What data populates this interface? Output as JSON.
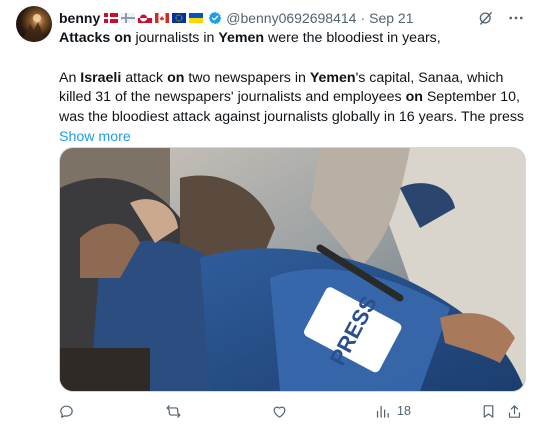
{
  "author": {
    "name": "benny",
    "handle": "@benny0692698414",
    "separator": "·",
    "date": "Sep 21",
    "flags": [
      "denmark-flag",
      "finland-flag",
      "greenland-flag",
      "canada-flag",
      "eu-flag",
      "ukraine-flag"
    ]
  },
  "tweet": {
    "line1": {
      "p1": "Attacks",
      "p2": " ",
      "p3": "on",
      "p4": " journalists in ",
      "p5": "Yemen",
      "p6": " were the bloodiest in years,"
    },
    "para2": {
      "p1": "An ",
      "p2": "Israeli",
      "p3": " attack ",
      "p4": "on",
      "p5": " two newspapers in ",
      "p6": "Yemen",
      "p7": "'s capital, Sanaa, which killed 31 of the newspapers' journalists and employees ",
      "p8": "on",
      "p9": " September 10, was the bloodiest attack against journalists globally in 16 years. The press"
    },
    "show_more": "Show more"
  },
  "media": {
    "vest_text": "PRESS"
  },
  "actions": {
    "views_count": "18"
  },
  "colors": {
    "text": "#0f1419",
    "muted": "#536471",
    "link": "#1d9bf0"
  }
}
